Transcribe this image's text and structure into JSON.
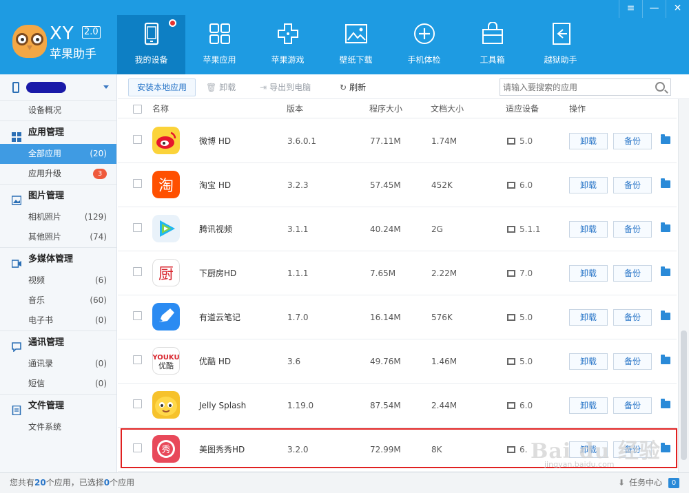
{
  "app": {
    "logo_text": "XY",
    "version": "2.0",
    "name": "苹果助手"
  },
  "nav": [
    {
      "label": "我的设备",
      "icon": "device-icon",
      "active": true,
      "has_dot": true
    },
    {
      "label": "苹果应用",
      "icon": "apps-grid-icon"
    },
    {
      "label": "苹果游戏",
      "icon": "gamepad-icon"
    },
    {
      "label": "壁纸下载",
      "icon": "wallpaper-icon"
    },
    {
      "label": "手机体检",
      "icon": "checkup-icon"
    },
    {
      "label": "工具箱",
      "icon": "toolbox-icon"
    },
    {
      "label": "越狱助手",
      "icon": "jailbreak-icon"
    }
  ],
  "window_controls": [
    "≡",
    "—",
    "✕"
  ],
  "sidebar": {
    "device_menu_item": "设备概况",
    "groups": [
      {
        "label": "应用管理",
        "icon": "app-manage-icon",
        "items": [
          {
            "label": "全部应用",
            "count": "(20)",
            "active": true
          },
          {
            "label": "应用升级",
            "badge": "3"
          }
        ]
      },
      {
        "label": "图片管理",
        "icon": "photo-icon",
        "items": [
          {
            "label": "相机照片",
            "count": "(129)"
          },
          {
            "label": "其他照片",
            "count": "(74)"
          }
        ]
      },
      {
        "label": "多媒体管理",
        "icon": "media-icon",
        "items": [
          {
            "label": "视频",
            "count": "(6)"
          },
          {
            "label": "音乐",
            "count": "(60)"
          },
          {
            "label": "电子书",
            "count": "(0)"
          }
        ]
      },
      {
        "label": "通讯管理",
        "icon": "chat-icon",
        "items": [
          {
            "label": "通讯录",
            "count": "(0)"
          },
          {
            "label": "短信",
            "count": "(0)"
          }
        ]
      },
      {
        "label": "文件管理",
        "icon": "file-icon",
        "items": [
          {
            "label": "文件系统"
          }
        ]
      }
    ]
  },
  "toolbar": {
    "install_label": "安装本地应用",
    "uninstall_label": "卸载",
    "export_label": "导出到电脑",
    "refresh_label": "刷新",
    "search_placeholder": "请输入要搜索的应用"
  },
  "table": {
    "headers": {
      "name": "名称",
      "version": "版本",
      "app_size": "程序大小",
      "doc_size": "文档大小",
      "device": "适应设备",
      "action": "操作"
    },
    "uninstall_btn": "卸载",
    "backup_btn": "备份",
    "rows": [
      {
        "name": "微博 HD",
        "version": "3.6.0.1",
        "app_size": "77.11M",
        "doc_size": "1.74M",
        "device": "5.0",
        "icon": "weibo-icon",
        "color": "#fbd33a"
      },
      {
        "name": "淘宝 HD",
        "version": "3.2.3",
        "app_size": "57.45M",
        "doc_size": "452K",
        "device": "6.0",
        "icon": "taobao-icon",
        "color": "#ff5000"
      },
      {
        "name": "腾讯视频",
        "version": "3.1.1",
        "app_size": "40.24M",
        "doc_size": "2G",
        "device": "5.1.1",
        "icon": "tencent-video-icon",
        "color": "#e9f2fa"
      },
      {
        "name": "下厨房HD",
        "version": "1.1.1",
        "app_size": "7.65M",
        "doc_size": "2.22M",
        "device": "7.0",
        "icon": "xiachufang-icon",
        "color": "#ffffff"
      },
      {
        "name": "有道云笔记",
        "version": "1.7.0",
        "app_size": "16.14M",
        "doc_size": "576K",
        "device": "5.0",
        "icon": "youdao-note-icon",
        "color": "#2b8bf2"
      },
      {
        "name": "优酷 HD",
        "version": "3.6",
        "app_size": "49.76M",
        "doc_size": "1.46M",
        "device": "5.0",
        "icon": "youku-icon",
        "color": "#ffffff"
      },
      {
        "name": "Jelly Splash",
        "version": "1.19.0",
        "app_size": "87.54M",
        "doc_size": "2.44M",
        "device": "6.0",
        "icon": "jelly-splash-icon",
        "color": "#f6c22c"
      },
      {
        "name": "美图秀秀HD",
        "version": "3.2.0",
        "app_size": "72.99M",
        "doc_size": "8K",
        "device": "6.",
        "icon": "meitu-icon",
        "color": "#e8495a"
      }
    ]
  },
  "status": {
    "prefix": "您共有",
    "total": "20",
    "mid": "个应用，已选择",
    "selected": "0",
    "suffix": "个应用",
    "task_label": "任务中心",
    "task_count": "0"
  },
  "watermark": {
    "text": "Bai du 经验",
    "sub": "jingyan.baidu.com"
  }
}
